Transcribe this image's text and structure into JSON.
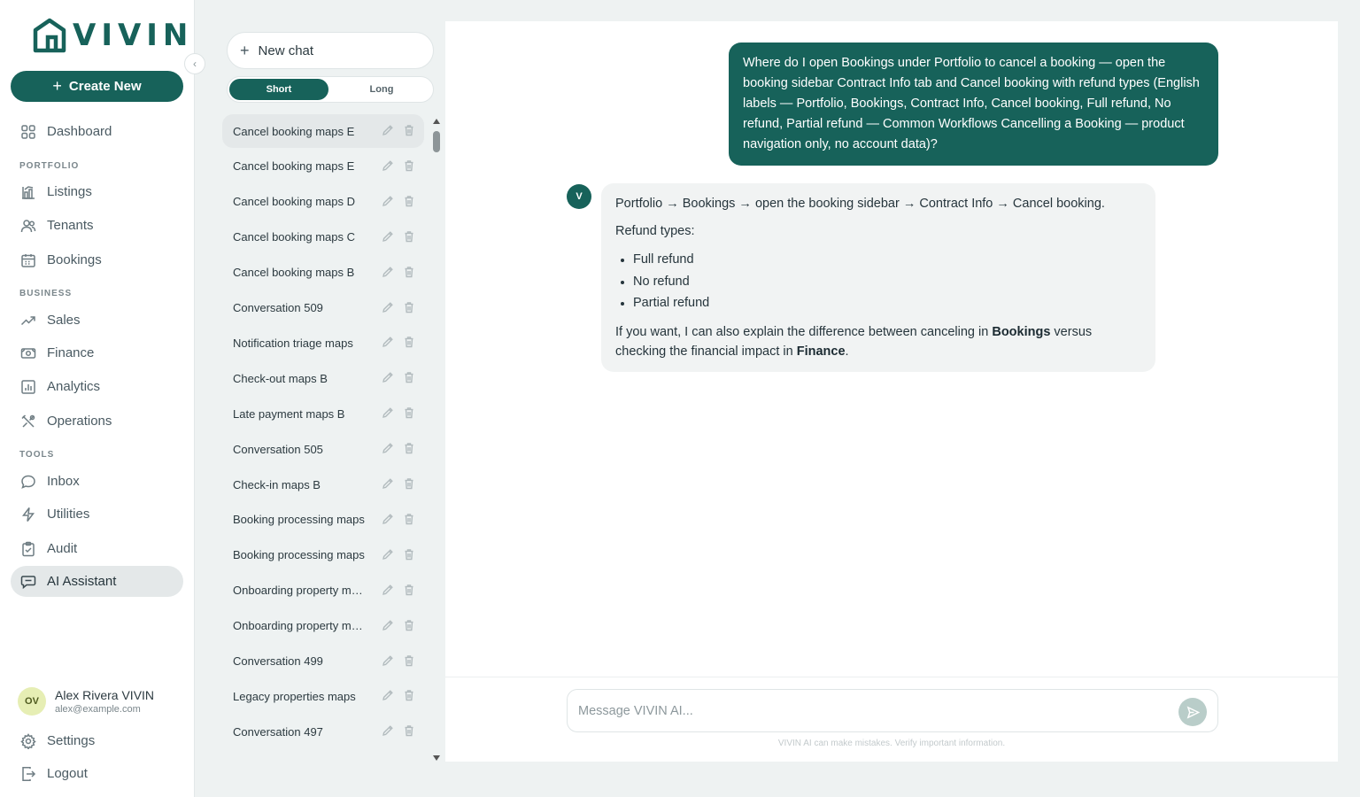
{
  "brand": {
    "logo_text": "VIVIN",
    "color": "#17625a"
  },
  "sidebar": {
    "create_label": "Create New",
    "items": {
      "dashboard": "Dashboard",
      "listings": "Listings",
      "tenants": "Tenants",
      "bookings": "Bookings",
      "sales": "Sales",
      "finance": "Finance",
      "analytics": "Analytics",
      "operations": "Operations",
      "inbox": "Inbox",
      "utilities": "Utilities",
      "audit": "Audit",
      "ai_assistant": "AI Assistant"
    },
    "sections": {
      "portfolio": "PORTFOLIO",
      "business": "BUSINESS",
      "tools": "TOOLS"
    },
    "active_item": "AI Assistant",
    "user": {
      "initials": "OV",
      "name": "Alex Rivera VIVIN",
      "email": "alex@example.com"
    },
    "settings_label": "Settings",
    "logout_label": "Logout"
  },
  "conversations": {
    "new_chat_label": "New chat",
    "length_toggle": {
      "short_label": "Short",
      "long_label": "Long",
      "selected": "Short"
    },
    "items": [
      "Cancel booking maps E",
      "Cancel booking maps E",
      "Cancel booking maps D",
      "Cancel booking maps C",
      "Cancel booking maps B",
      "Conversation 509",
      "Notification triage maps",
      "Check-out maps B",
      "Late payment maps B",
      "Conversation 505",
      "Check-in maps B",
      "Booking processing maps",
      "Booking processing maps",
      "Onboarding property maps",
      "Onboarding property maps",
      "Conversation 499",
      "Legacy properties maps",
      "Conversation 497"
    ]
  },
  "chat": {
    "user_message": "Where do I open Bookings under Portfolio to cancel a booking — open the booking sidebar Contract Info tab and Cancel booking with refund types (English labels — Portfolio, Bookings, Contract Info, Cancel booking, Full refund, No refund, Partial refund — Common Workflows Cancelling a Booking — product navigation only, no account data)?",
    "assistant": {
      "avatar_letter": "V",
      "path": "Portfolio → Bookings → open the booking sidebar → Contract Info → Cancel booking.",
      "refund_heading": "Refund types:",
      "refund_types": [
        "Full refund",
        "No refund",
        "Partial refund"
      ],
      "outro_1": "If you want, I can also explain the difference between canceling in ",
      "outro_bold_1": "Bookings",
      "outro_2": " versus checking the financial impact in ",
      "outro_bold_2": "Finance",
      "outro_3": "."
    },
    "composer_placeholder": "Message VIVIN AI...",
    "disclaimer": "VIVIN AI can make mistakes. Verify important information."
  }
}
